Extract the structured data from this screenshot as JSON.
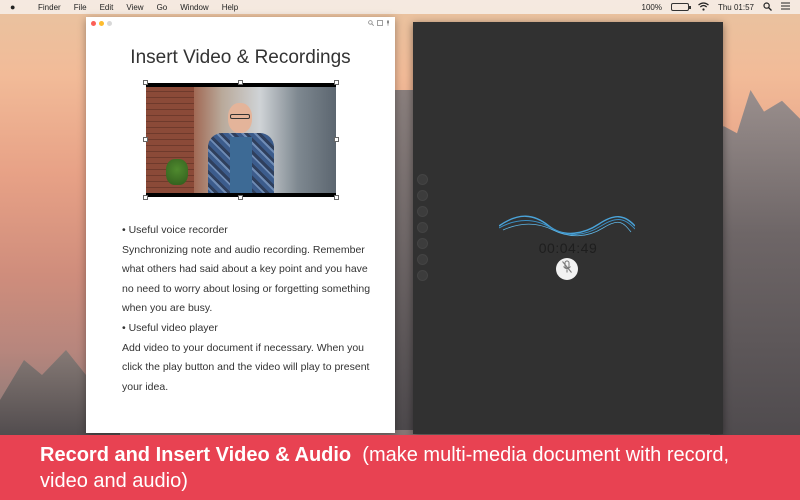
{
  "menubar": {
    "apple": "",
    "items": [
      "Finder",
      "File",
      "Edit",
      "View",
      "Go",
      "Window",
      "Help"
    ],
    "battery_text": "100%",
    "battery_level": 1.0,
    "clock": "Thu 01:57"
  },
  "document": {
    "title": "Insert Video & Recordings",
    "bullet1": "• Useful voice recorder",
    "para1": "Synchronizing note and audio recording. Remember what others had said about a key point and you have no need to worry about losing or forgetting something when you are busy.",
    "bullet2": "• Useful video player",
    "para2": "Add video to your document if necessary. When you click the play button and the video will  play to present your idea."
  },
  "recorder": {
    "timer": "00:04:49"
  },
  "banner": {
    "headline": "Record and Insert Video & Audio",
    "subtitle": "(make multi-media document with record, video and audio)"
  },
  "colors": {
    "banner": "#e84252",
    "recorder_bg": "#313131",
    "wave": "#4aa3d9"
  }
}
